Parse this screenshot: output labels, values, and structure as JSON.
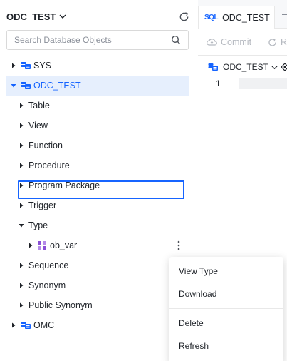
{
  "sidebar": {
    "title": "ODC_TEST",
    "search_placeholder": "Search Database Objects",
    "tree": {
      "sys": "SYS",
      "odc_test": "ODC_TEST",
      "table": "Table",
      "view": "View",
      "function": "Function",
      "procedure": "Procedure",
      "program_package": "Program Package",
      "trigger": "Trigger",
      "type": "Type",
      "ob_var": "ob_var",
      "sequence": "Sequence",
      "synonym": "Synonym",
      "public_synonym": "Public Synonym",
      "omc": "OMC"
    }
  },
  "editor": {
    "tab_badge": "SQL",
    "tab_label": "ODC_TEST",
    "toolbar": {
      "commit": "Commit",
      "second": "R"
    },
    "connection": "ODC_TEST",
    "line_number": "1"
  },
  "context_menu": {
    "view_type": "View Type",
    "download": "Download",
    "delete": "Delete",
    "refresh": "Refresh"
  },
  "colors": {
    "accent": "#1664ff",
    "selected_bg": "#e6effd",
    "type_icon": "#8a4fd6",
    "disabled_text": "#b5b9c0"
  },
  "icons": [
    "chevron-down-icon",
    "refresh-icon",
    "search-icon",
    "caret-right-icon",
    "caret-down-icon",
    "database-icon",
    "type-object-icon",
    "more-vertical-icon",
    "commit-icon",
    "rollback-icon",
    "target-icon"
  ]
}
